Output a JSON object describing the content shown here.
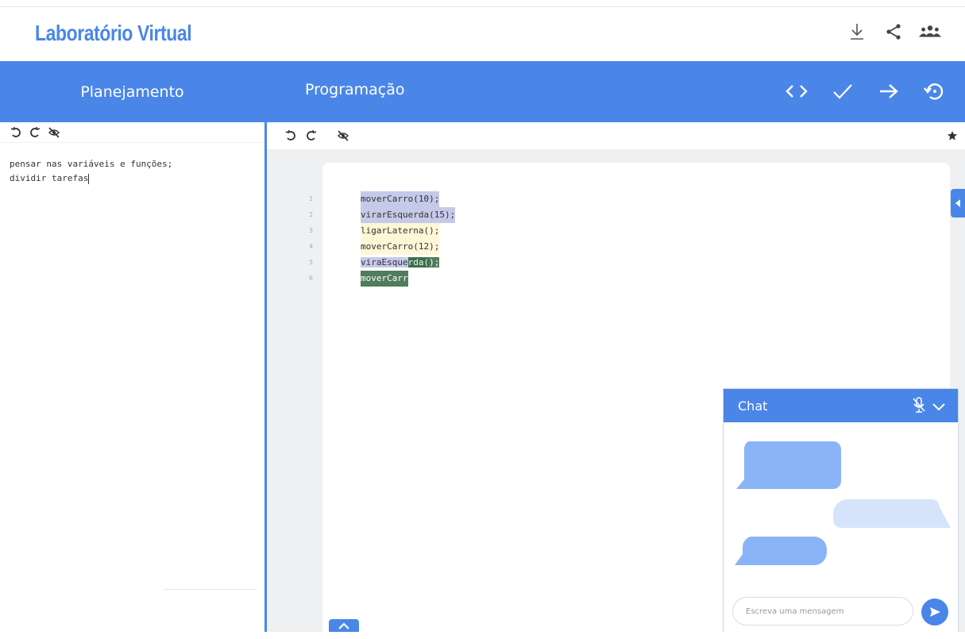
{
  "app": {
    "title": "Laboratório Virtual"
  },
  "top_actions": [
    {
      "name": "download-icon"
    },
    {
      "name": "share-icon"
    },
    {
      "name": "group-icon"
    }
  ],
  "planning": {
    "header": "Planejamento",
    "toolbar": [
      "undo-icon",
      "redo-icon",
      "eye-off-icon"
    ],
    "text_lines": [
      "pensar nas variáveis e funções;",
      "dividir tarefas"
    ]
  },
  "programming": {
    "header": "Programação",
    "header_tools": [
      "code-icon",
      "check-icon",
      "arrow-right-icon",
      "history-icon"
    ],
    "toolbar": [
      "undo-icon",
      "redo-icon",
      "eye-off-icon",
      "star-icon"
    ],
    "code": [
      {
        "n": "1",
        "text": "moverCarro(10);"
      },
      {
        "n": "2",
        "text": "virarEsquerda(15);"
      },
      {
        "n": "3",
        "text": "ligarLaterna();"
      },
      {
        "n": "4",
        "text": "moverCarro(12);"
      },
      {
        "n": "5",
        "text_a": "viraEsque",
        "text_b": "rda(",
        "text_c": ");"
      },
      {
        "n": "6",
        "text": "moverCarr"
      }
    ]
  },
  "chat": {
    "title": "Chat",
    "input_placeholder": "Escreva uma mensagem"
  },
  "colors": {
    "accent": "#4a86e8",
    "bubble_dark": "#8ab4f8",
    "bubble_light": "#d6e4fb"
  }
}
